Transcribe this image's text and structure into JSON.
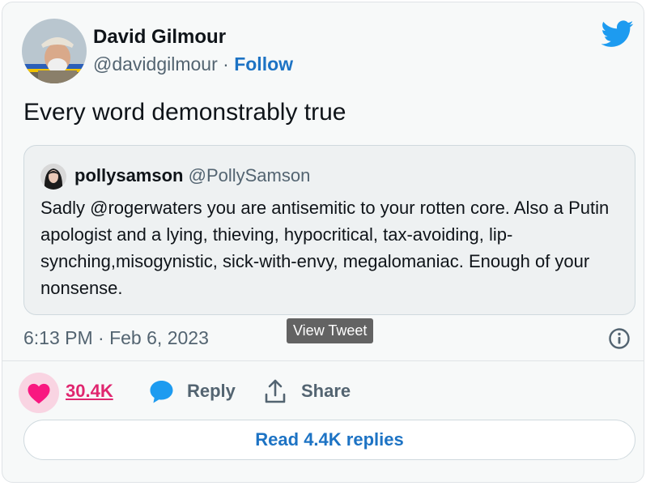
{
  "author": {
    "name": "David Gilmour",
    "handle": "@davidgilmour",
    "separator": "·",
    "follow_label": "Follow"
  },
  "tweet": {
    "text": "Every word demonstrably true",
    "timestamp": "6:13 PM · Feb 6, 2023"
  },
  "quoted_tweet": {
    "name": "pollysamson",
    "handle": "@PollySamson",
    "text": "Sadly @rogerwaters you are antisemitic to your rotten core. Also a Putin apologist and a lying, thieving, hypocritical, tax-avoiding, lip-synching,misogynistic, sick-with-envy, megalomaniac. Enough of your nonsense."
  },
  "tooltip": {
    "label": "View Tweet"
  },
  "actions": {
    "like_count": "30.4K",
    "reply_label": "Reply",
    "share_label": "Share"
  },
  "footer": {
    "read_replies_label": "Read 4.4K replies"
  },
  "icons": {
    "brand": "twitter-bird-icon",
    "info": "info-icon",
    "like": "heart-icon",
    "reply": "speech-bubble-icon",
    "share": "upload-arrow-icon"
  },
  "colors": {
    "brand_blue": "#1d9bf0",
    "link_blue": "#1d73c4",
    "like_pink": "#f91880",
    "muted_text": "#536471",
    "card_background": "#f7f9f9"
  }
}
